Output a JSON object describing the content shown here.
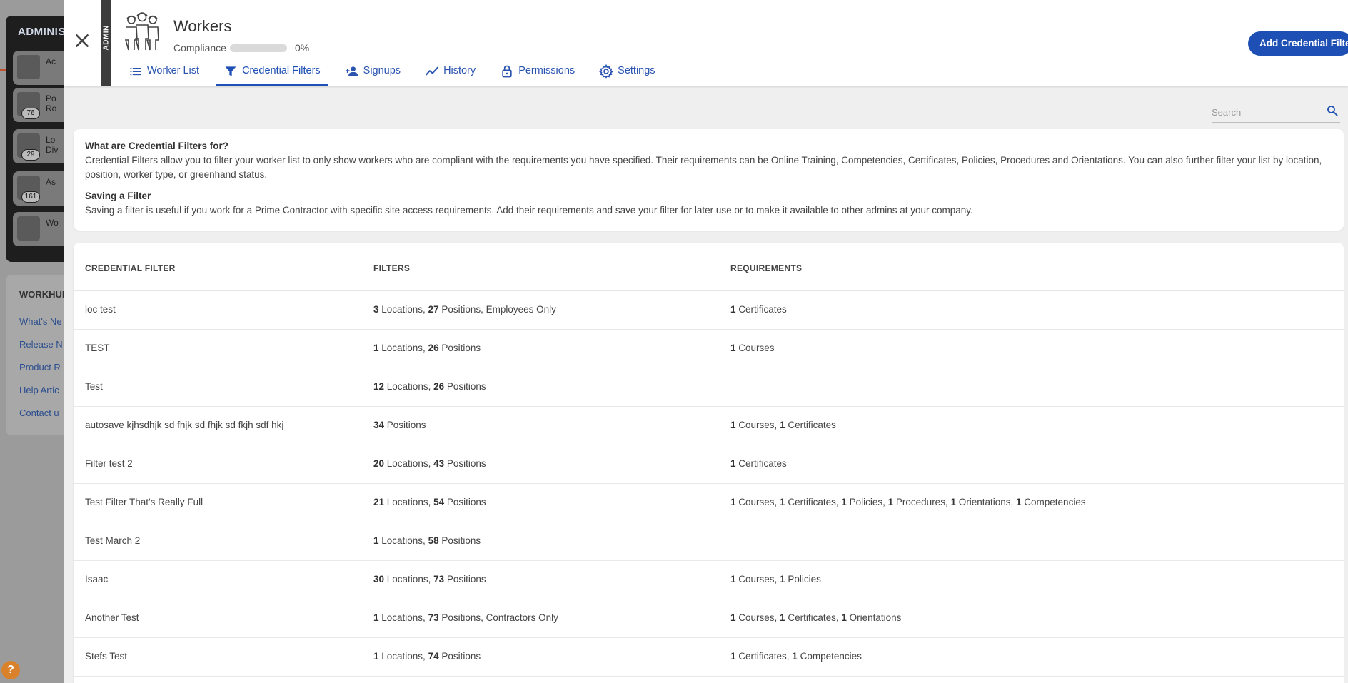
{
  "background": {
    "admin_title": "ADMINIS",
    "items": [
      {
        "text": "Ac",
        "badge": ""
      },
      {
        "text": "Po\nRo",
        "badge": "76"
      },
      {
        "text": "Lo\nDiv",
        "badge": "29"
      },
      {
        "text": "As",
        "badge": "161"
      },
      {
        "text": "Wo",
        "badge": ""
      }
    ],
    "workhub_title": "WORKHUI",
    "links": [
      "What's Ne",
      "Release N",
      "Product R",
      "Help Artic",
      "Contact u"
    ],
    "help_label": "?"
  },
  "header": {
    "admin_label": "ADMIN",
    "title": "Workers",
    "compliance_label": "Compliance",
    "compliance_percent": "0%",
    "compliance_value": 0,
    "add_button": "Add Credential Filter"
  },
  "tabs": [
    {
      "label": "Worker List",
      "icon": "list-icon",
      "active": false
    },
    {
      "label": "Credential Filters",
      "icon": "filter-icon",
      "active": true
    },
    {
      "label": "Signups",
      "icon": "add-person-icon",
      "active": false
    },
    {
      "label": "History",
      "icon": "trend-icon",
      "active": false
    },
    {
      "label": "Permissions",
      "icon": "lock-icon",
      "active": false
    },
    {
      "label": "Settings",
      "icon": "gear-icon",
      "active": false
    }
  ],
  "search": {
    "placeholder": "Search"
  },
  "info": {
    "heading1": "What are Credential Filters for?",
    "text1": "Credential Filters allow you to filter your worker list to only show workers who are compliant with the requirements you have specified. Their requirements can be Online Training, Competencies, Certificates, Policies, Procedures and Orientations. You can also further filter your list by location, position, worker type, or greenhand status.",
    "heading2": "Saving a Filter",
    "text2": "Saving a filter is useful if you work for a Prime Contractor with specific site access requirements. Add their requirements and save your filter for later use or to make it available to other admins at your company."
  },
  "table": {
    "columns": [
      "CREDENTIAL FILTER",
      "FILTERS",
      "REQUIREMENTS"
    ],
    "rows": [
      {
        "name": "loc test",
        "filters": "3 Locations, 27 Positions, Employees Only",
        "requirements": "1 Certificates"
      },
      {
        "name": "TEST",
        "filters": "1 Locations, 26 Positions",
        "requirements": "1 Courses"
      },
      {
        "name": "Test",
        "filters": "12 Locations, 26 Positions",
        "requirements": ""
      },
      {
        "name": "autosave kjhsdhjk sd fhjk sd fhjk sd fkjh sdf hkj",
        "filters": "34 Positions",
        "requirements": "1 Courses, 1 Certificates"
      },
      {
        "name": "Filter test 2",
        "filters": "20 Locations, 43 Positions",
        "requirements": "1 Certificates"
      },
      {
        "name": "Test Filter That's Really Full",
        "filters": "21 Locations, 54 Positions",
        "requirements": "1 Courses, 1 Certificates, 1 Policies, 1 Procedures, 1 Orientations, 1 Competencies"
      },
      {
        "name": "Test March 2",
        "filters": "1 Locations, 58 Positions",
        "requirements": ""
      },
      {
        "name": "Isaac",
        "filters": "30 Locations, 73 Positions",
        "requirements": "1 Courses, 1 Policies"
      },
      {
        "name": "Another Test",
        "filters": "1 Locations, 73 Positions, Contractors Only",
        "requirements": "1 Courses, 1 Certificates, 1 Orientations"
      },
      {
        "name": "Stefs Test",
        "filters": "1 Locations, 74 Positions",
        "requirements": "1 Certificates, 1 Competencies"
      }
    ]
  },
  "colors": {
    "accent": "#1e4fb4",
    "tab_text": "#2a54b0"
  }
}
